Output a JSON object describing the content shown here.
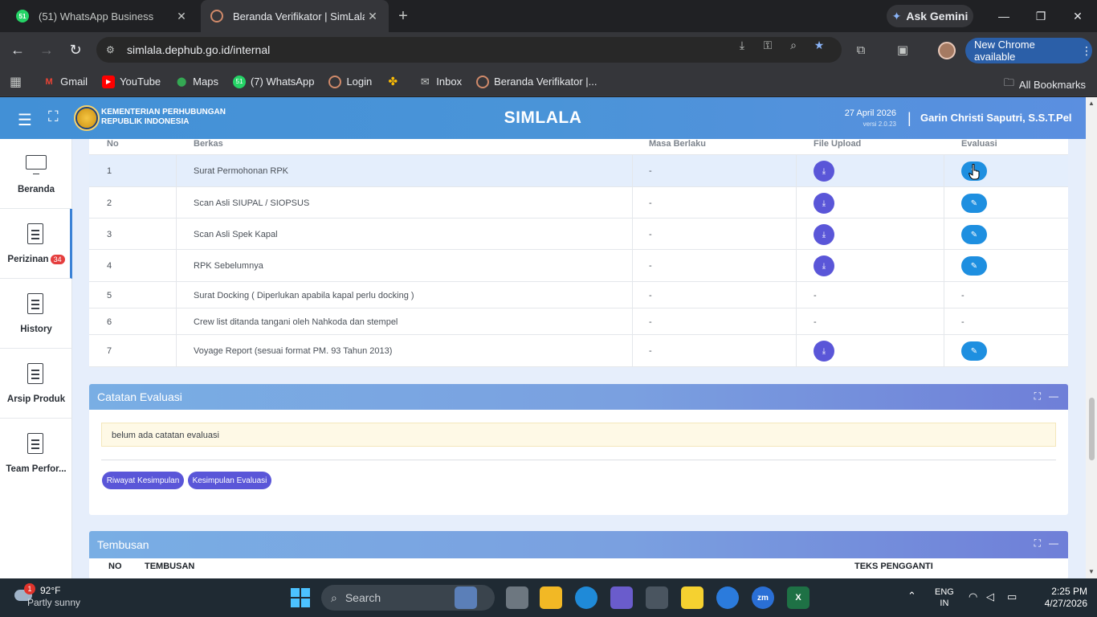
{
  "browser": {
    "tabs": [
      {
        "title": "(51) WhatsApp Business",
        "favicon_text": "51"
      },
      {
        "title": "Beranda Verifikator | SimLala"
      }
    ],
    "ask_gemini": "Ask Gemini",
    "url": "simlala.dephub.go.id/internal",
    "new_chrome": "New Chrome available",
    "bookmarks": [
      {
        "label": "Gmail",
        "icon": "gmail-icon"
      },
      {
        "label": "YouTube",
        "icon": "youtube-icon"
      },
      {
        "label": "Maps",
        "icon": "maps-icon"
      },
      {
        "label": "(7) WhatsApp",
        "icon": "whatsapp-icon",
        "badge": "51"
      },
      {
        "label": "Login",
        "icon": "simlala-icon"
      },
      {
        "label": "",
        "icon": "pinwheel-icon"
      },
      {
        "label": "Inbox",
        "icon": "mail-icon"
      },
      {
        "label": "Beranda Verifikator |...",
        "icon": "simlala-icon"
      }
    ],
    "all_bookmarks": "All Bookmarks"
  },
  "app": {
    "ministry_line1": "KEMENTERIAN PERHUBUNGAN",
    "ministry_line2": "REPUBLIK INDONESIA",
    "title": "SIMLALA",
    "date": "27 April 2026",
    "version": "versi 2.0.23",
    "divider": "|",
    "user": "Garin Christi Saputri, S.S.T.Pel"
  },
  "sidebar": {
    "items": [
      {
        "label": "Beranda",
        "icon": "monitor-icon"
      },
      {
        "label": "Perizinan",
        "icon": "document-icon",
        "badge": "34"
      },
      {
        "label": "History",
        "icon": "document-icon"
      },
      {
        "label": "Arsip Produk",
        "icon": "document-icon"
      },
      {
        "label": "Team Perfor...",
        "icon": "document-icon"
      }
    ]
  },
  "documents": {
    "headers": {
      "no": "No",
      "berkas": "Berkas",
      "masa": "Masa Berlaku",
      "upload": "File Upload",
      "evaluasi": "Evaluasi"
    },
    "rows": [
      {
        "no": "1",
        "berkas": "Surat Permohonan RPK",
        "masa": "-",
        "upload": "download",
        "evaluasi": "edit"
      },
      {
        "no": "2",
        "berkas": "Scan Asli SIUPAL / SIOPSUS",
        "masa": "-",
        "upload": "download",
        "evaluasi": "edit"
      },
      {
        "no": "3",
        "berkas": "Scan Asli Spek Kapal",
        "masa": "-",
        "upload": "download",
        "evaluasi": "edit"
      },
      {
        "no": "4",
        "berkas": "RPK Sebelumnya",
        "masa": "-",
        "upload": "download",
        "evaluasi": "edit"
      },
      {
        "no": "5",
        "berkas": "Surat Docking ( Diperlukan apabila kapal perlu docking )",
        "masa": "-",
        "upload": "-",
        "evaluasi": "-"
      },
      {
        "no": "6",
        "berkas": "Crew list ditanda tangani oleh Nahkoda dan stempel",
        "masa": "-",
        "upload": "-",
        "evaluasi": "-"
      },
      {
        "no": "7",
        "berkas": "Voyage Report (sesuai format PM. 93 Tahun 2013)",
        "masa": "-",
        "upload": "download",
        "evaluasi": "edit"
      }
    ]
  },
  "catatan": {
    "title": "Catatan Evaluasi",
    "note": "belum ada catatan evaluasi",
    "btn_riwayat": "Riwayat Kesimpulan",
    "btn_kesimpulan": "Kesimpulan Evaluasi"
  },
  "tembusan": {
    "title": "Tembusan",
    "col_no": "NO",
    "col_tembusan": "TEMBUSAN",
    "col_teks": "TEKS PENGGANTI"
  },
  "taskbar": {
    "weather_badge": "1",
    "temp": "92°F",
    "condition": "Partly sunny",
    "search": "Search",
    "lang1": "ENG",
    "lang2": "IN",
    "time": "2:25 PM",
    "date": "4/27/2026"
  }
}
